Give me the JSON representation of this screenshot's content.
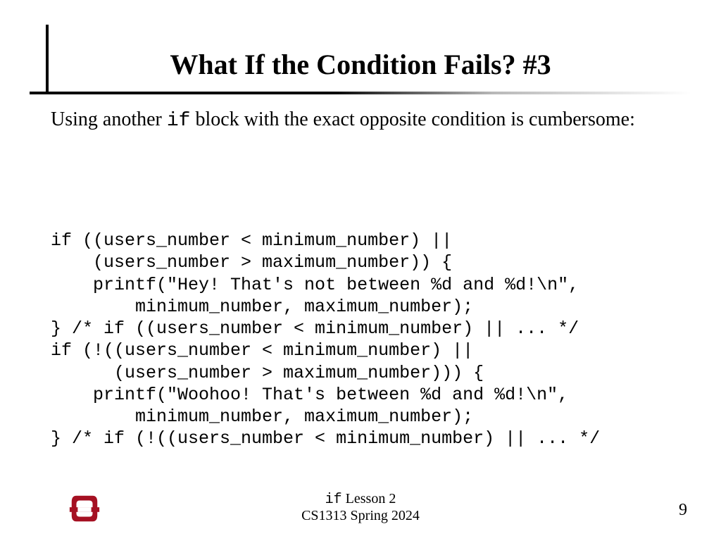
{
  "title": "What If the Condition Fails? #3",
  "body": {
    "pre": "Using  another ",
    "kw": "if",
    "post": " block with the exact opposite condition is cumbersome:"
  },
  "code": "if ((users_number < minimum_number) ||\n    (users_number > maximum_number)) {\n    printf(\"Hey! That's not between %d and %d!\\n\",\n        minimum_number, maximum_number);\n} /* if ((users_number < minimum_number) || ... */\nif (!((users_number < minimum_number) ||\n      (users_number > maximum_number))) {\n    printf(\"Woohoo! That's between %d and %d!\\n\",\n        minimum_number, maximum_number);\n} /* if (!((users_number < minimum_number) || ... */",
  "footer": {
    "kw": "if",
    "lesson": " Lesson 2",
    "course": "CS1313 Spring 2024"
  },
  "page": "9",
  "logo_color": "#a51022"
}
